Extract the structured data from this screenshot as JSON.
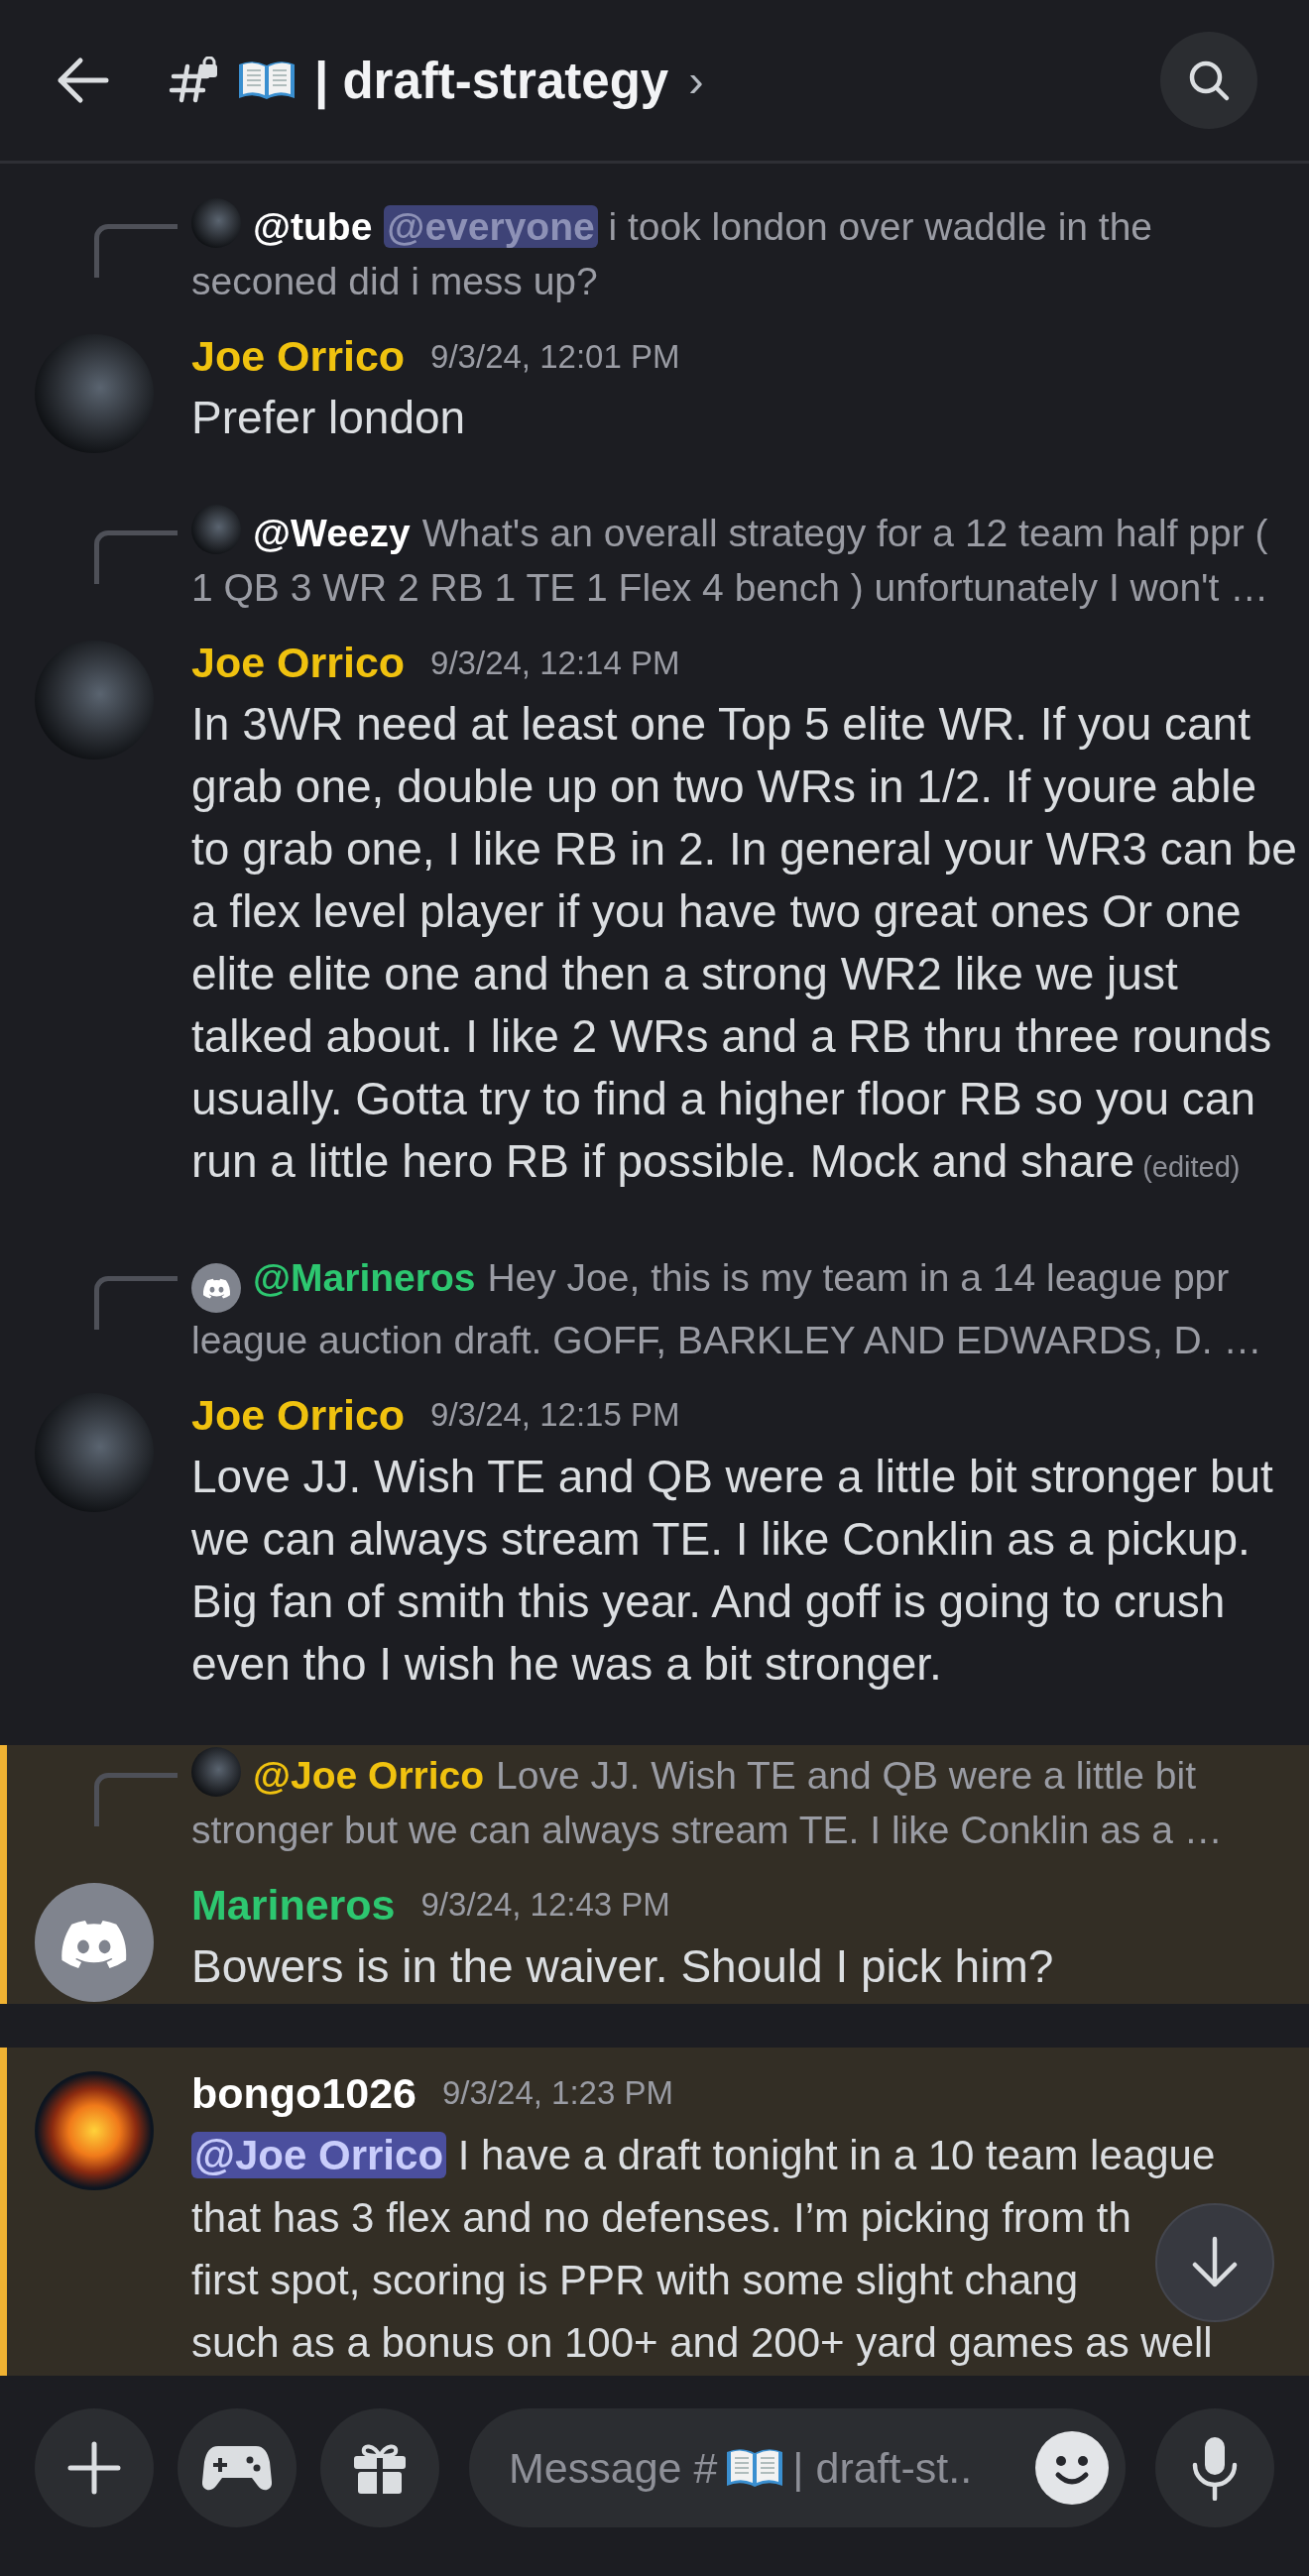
{
  "header": {
    "channel_name": "| draft-strategy",
    "chevron": "›"
  },
  "messages": [
    {
      "reply": {
        "author": {
          "name": "@tube",
          "color": "#ffffff"
        },
        "avatar": {
          "kind": "photo"
        },
        "mention": "@everyone",
        "text": "i took london over waddle in the seconed did i mess up?"
      },
      "avatar": {
        "kind": "photo"
      },
      "author": {
        "name": "Joe Orrico",
        "color": "#f0c20f"
      },
      "timestamp": "9/3/24, 12:01 PM",
      "text": "Prefer london",
      "highlighted": false
    },
    {
      "reply": {
        "author": {
          "name": "@Weezy",
          "color": "#ffffff"
        },
        "avatar": {
          "kind": "photo"
        },
        "text": "What's an overall strategy for a 12 team half ppr ( 1 QB 3 WR 2 RB 1 TE 1 Flex 4 bench ) unfortunately I won't …"
      },
      "avatar": {
        "kind": "photo"
      },
      "author": {
        "name": "Joe Orrico",
        "color": "#f0c20f"
      },
      "timestamp": "9/3/24, 12:14 PM",
      "text": "In 3WR need at least one Top 5 elite WR. If you cant grab one, double up on two WRs in 1/2. If youre able to grab one, I like RB in 2. In general your WR3 can be a flex level player if you have two great ones Or one elite elite one and then a strong WR2 like we just talked about. I like 2 WRs and a RB thru three rounds usually. Gotta try to find a higher floor RB so you can run a little hero RB if possible. Mock and share",
      "edited": "(edited)",
      "highlighted": false
    },
    {
      "reply": {
        "author": {
          "name": "@Marineros",
          "color": "#2dc770"
        },
        "avatar": {
          "kind": "default"
        },
        "text": "Hey Joe, this is my team in a 14 league ppr league auction draft. GOFF, BARKLEY AND EDWARDS, D. …"
      },
      "avatar": {
        "kind": "photo"
      },
      "author": {
        "name": "Joe Orrico",
        "color": "#f0c20f"
      },
      "timestamp": "9/3/24, 12:15 PM",
      "text": "Love JJ. Wish TE and QB were a little bit stronger but we can always stream TE. I like Conklin as a pickup. Big fan of smith this year. And goff is going to crush even tho I wish he was a bit stronger.",
      "highlighted": false
    },
    {
      "reply": {
        "author": {
          "name": "@Joe Orrico",
          "color": "#f0c20f"
        },
        "avatar": {
          "kind": "photo"
        },
        "text": "Love JJ. Wish TE and QB were a little bit stronger but we can always stream TE. I like Conklin as a …"
      },
      "avatar": {
        "kind": "default"
      },
      "author": {
        "name": "Marineros",
        "color": "#2dc770"
      },
      "timestamp": "9/3/24, 12:43 PM",
      "text": "Bowers is in the waiver. Should I pick him?",
      "highlighted": true
    },
    {
      "avatar": {
        "kind": "artwork"
      },
      "author": {
        "name": "bongo1026",
        "color": "#ffffff"
      },
      "timestamp": "9/3/24, 1:23 PM",
      "mention": "@Joe Orrico",
      "lines": [
        "I have a draft tonight in a 10 team league",
        "that has 3 flex and no defenses. I’m picking from th",
        "first spot, scoring is PPR with some slight chang",
        "such as a bonus on 100+ and 200+ yard games as well"
      ],
      "highlighted": true
    }
  ],
  "composer": {
    "placeholder_start": "Message #",
    "placeholder_end": "| draft-st.."
  }
}
